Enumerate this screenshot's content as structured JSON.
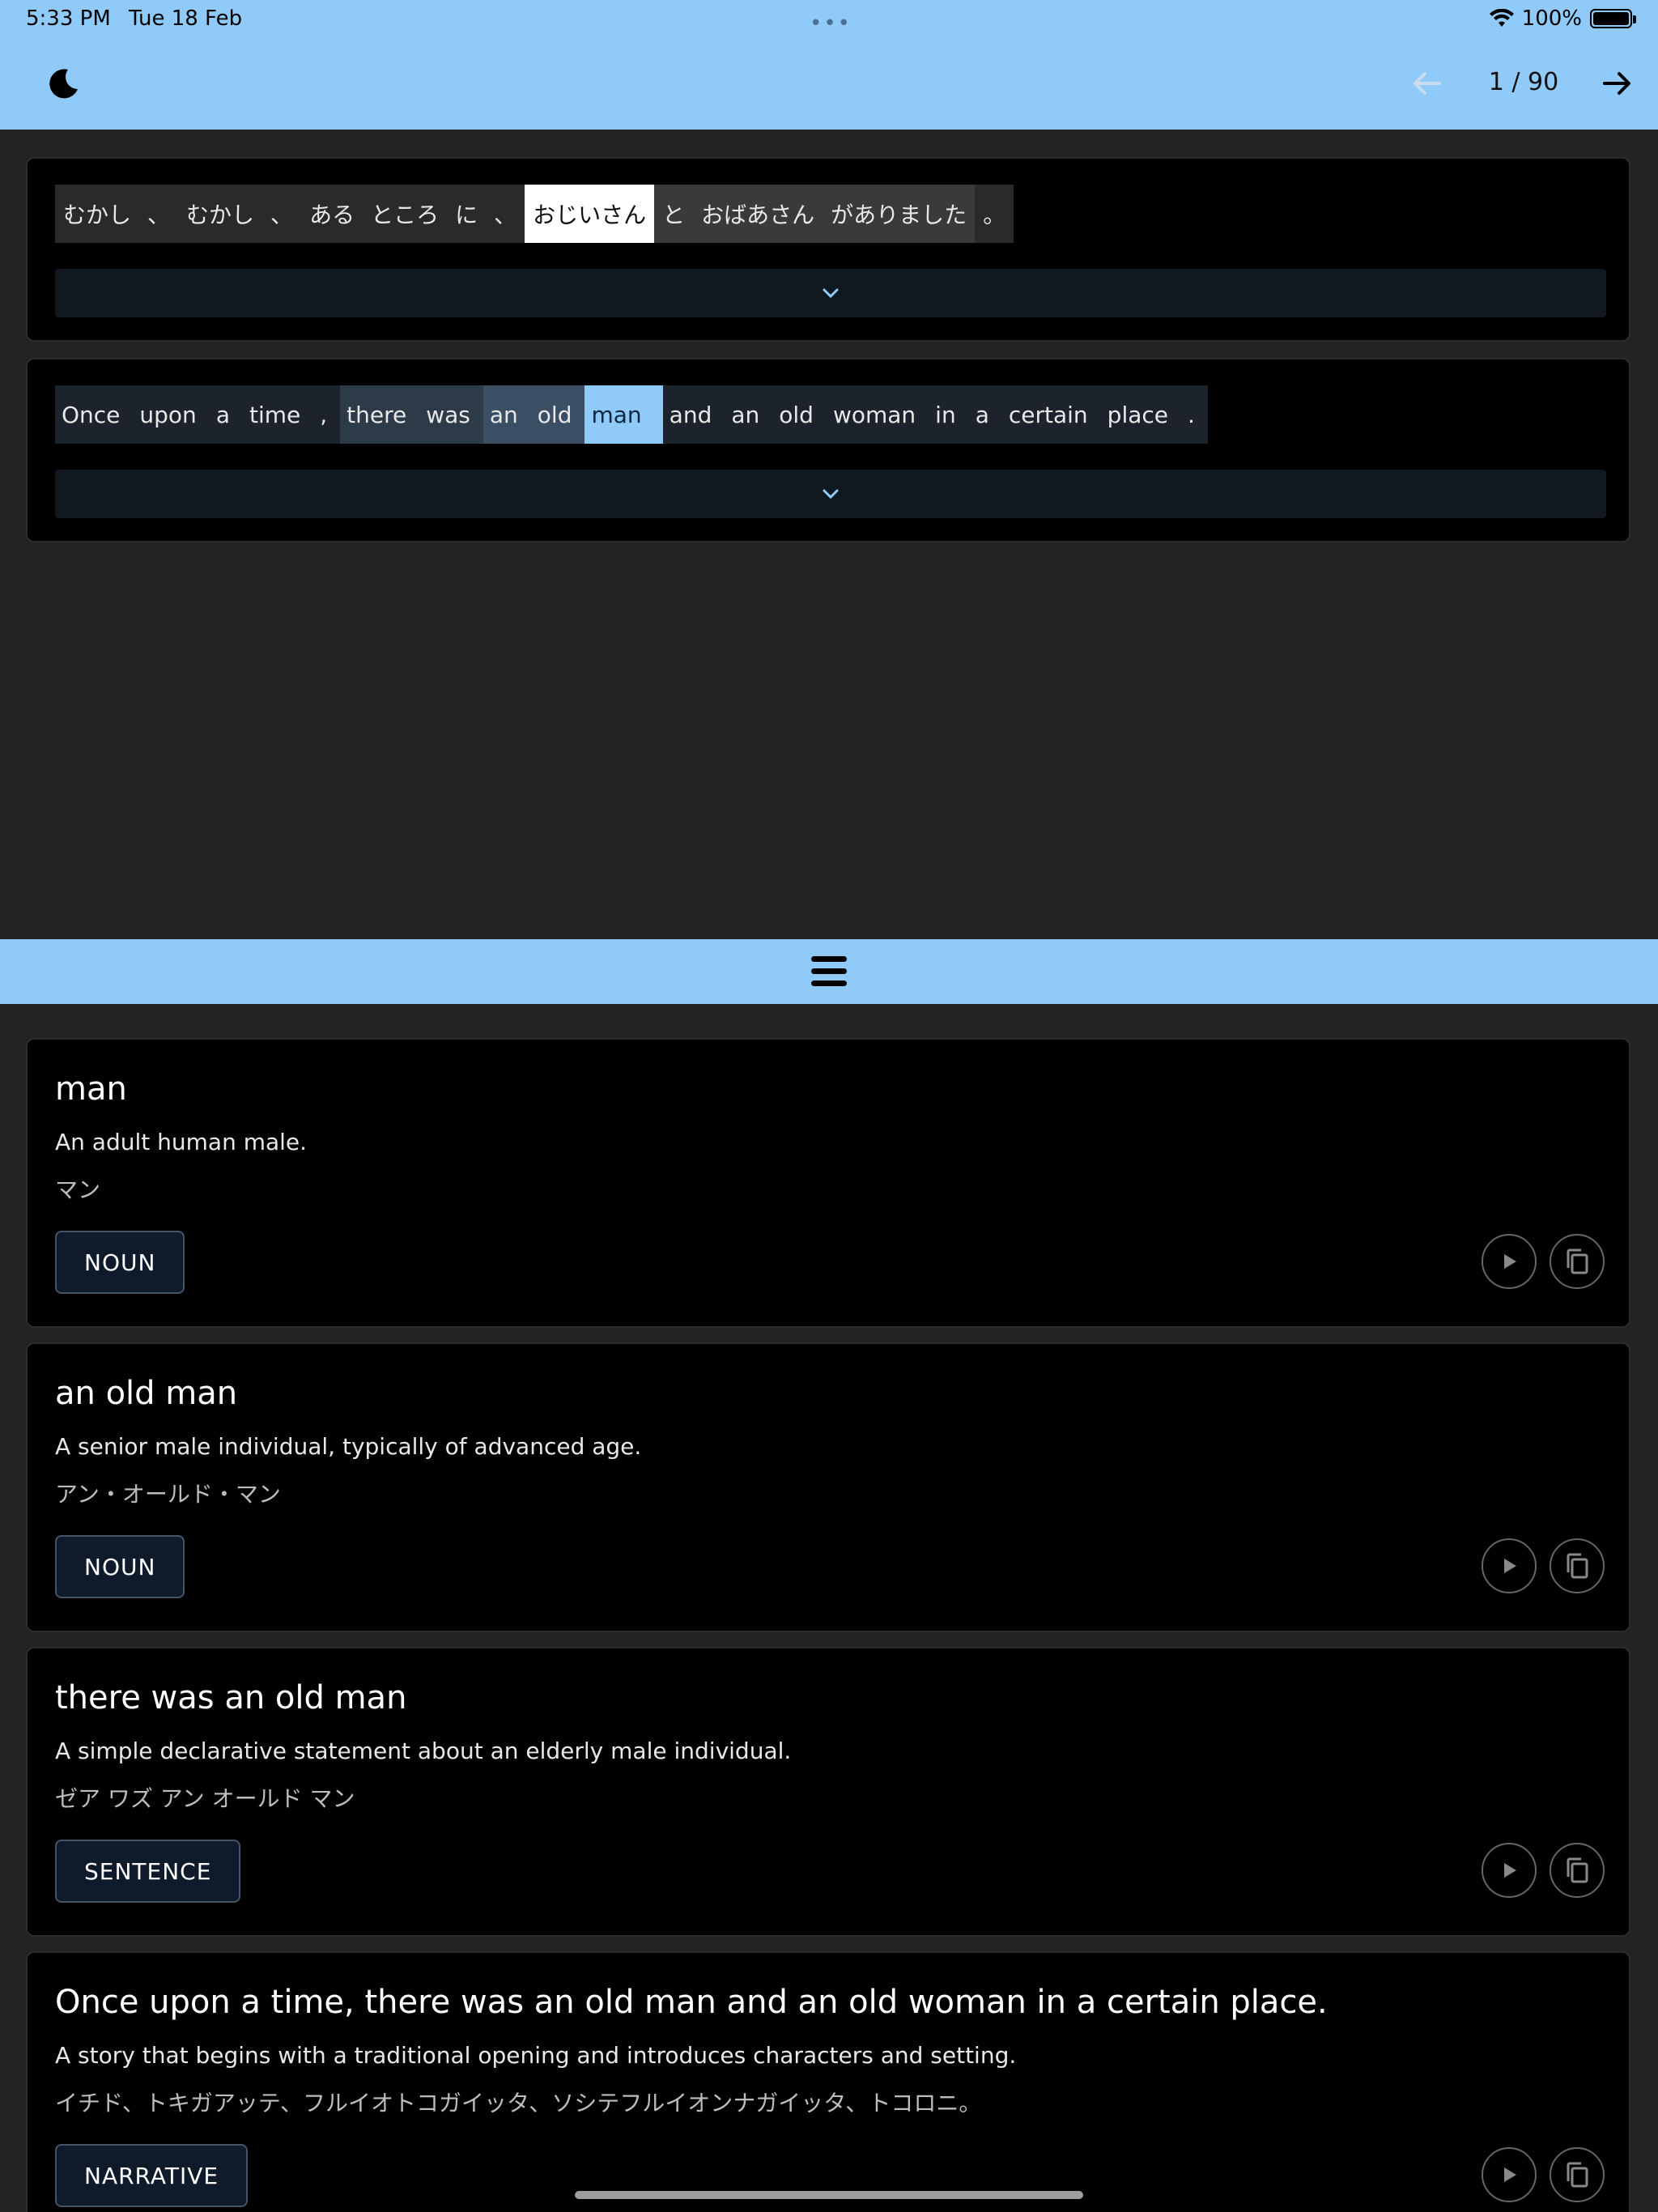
{
  "status_bar": {
    "time": "5:33 PM",
    "date": "Tue 18 Feb",
    "battery": "100%",
    "icons": [
      "wifi-icon",
      "battery-icon"
    ]
  },
  "app_bar": {
    "page_counter": "1 / 90",
    "icons": [
      "moon-icon",
      "arrow-left-icon",
      "arrow-right-icon"
    ]
  },
  "japanese_sentence": {
    "tokens": [
      {
        "text": "むかし",
        "style": "plain"
      },
      {
        "text": "、",
        "style": "plain"
      },
      {
        "text": "むかし",
        "style": "plain"
      },
      {
        "text": "、",
        "style": "plain"
      },
      {
        "text": "ある",
        "style": "plain"
      },
      {
        "text": "ところ",
        "style": "plain"
      },
      {
        "text": "に",
        "style": "plain"
      },
      {
        "text": "、",
        "style": "plain"
      },
      {
        "text": "おじいさん",
        "style": "selected"
      },
      {
        "text": "と",
        "style": "group"
      },
      {
        "text": "おばあさん",
        "style": "group"
      },
      {
        "text": "がありました",
        "style": "group"
      },
      {
        "text": "。",
        "style": "plain"
      }
    ]
  },
  "english_sentence": {
    "tokens": [
      {
        "text": "Once",
        "style": "plain"
      },
      {
        "text": "upon",
        "style": "plain"
      },
      {
        "text": "a",
        "style": "plain"
      },
      {
        "text": "time",
        "style": "plain"
      },
      {
        "text": ",",
        "style": "plain"
      },
      {
        "text": "there",
        "style": "group1"
      },
      {
        "text": "was",
        "style": "group1"
      },
      {
        "text": "an",
        "style": "group2"
      },
      {
        "text": "old",
        "style": "group2"
      },
      {
        "text": "man",
        "style": "selected"
      },
      {
        "text": "and",
        "style": "plain"
      },
      {
        "text": "an",
        "style": "plain"
      },
      {
        "text": "old",
        "style": "plain"
      },
      {
        "text": "woman",
        "style": "plain"
      },
      {
        "text": "in",
        "style": "plain"
      },
      {
        "text": "a",
        "style": "plain"
      },
      {
        "text": "certain",
        "style": "plain"
      },
      {
        "text": "place",
        "style": "plain"
      },
      {
        "text": ".",
        "style": "plain"
      }
    ]
  },
  "definitions": [
    {
      "term": "man",
      "description": "An adult human male.",
      "reading": "マン",
      "tag": "NOUN"
    },
    {
      "term": "an old man",
      "description": "A senior male individual, typically of advanced age.",
      "reading": "アン・オールド・マン",
      "tag": "NOUN"
    },
    {
      "term": "there was an old man",
      "description": "A simple declarative statement about an elderly male individual.",
      "reading": "ゼア ワズ アン オールド マン",
      "tag": "SENTENCE"
    },
    {
      "term": "Once upon a time, there was an old man and an old woman in a certain place.",
      "description": "A story that begins with a traditional opening and introduces characters and setting.",
      "reading": "イチド、トキガアッテ、フルイオトコガイッタ、ソシテフルイオンナガイッタ、トコロニ。",
      "tag": "NARRATIVE"
    }
  ],
  "colors": {
    "accent": "#90caf9",
    "background": "#232323",
    "card": "#000000",
    "jp_group": "#3a3a3a",
    "jp_plain": "#2a2a2a",
    "en_plain": "#1c232c",
    "en_group1": "#2d3a48",
    "en_group2": "#3a4f63"
  }
}
